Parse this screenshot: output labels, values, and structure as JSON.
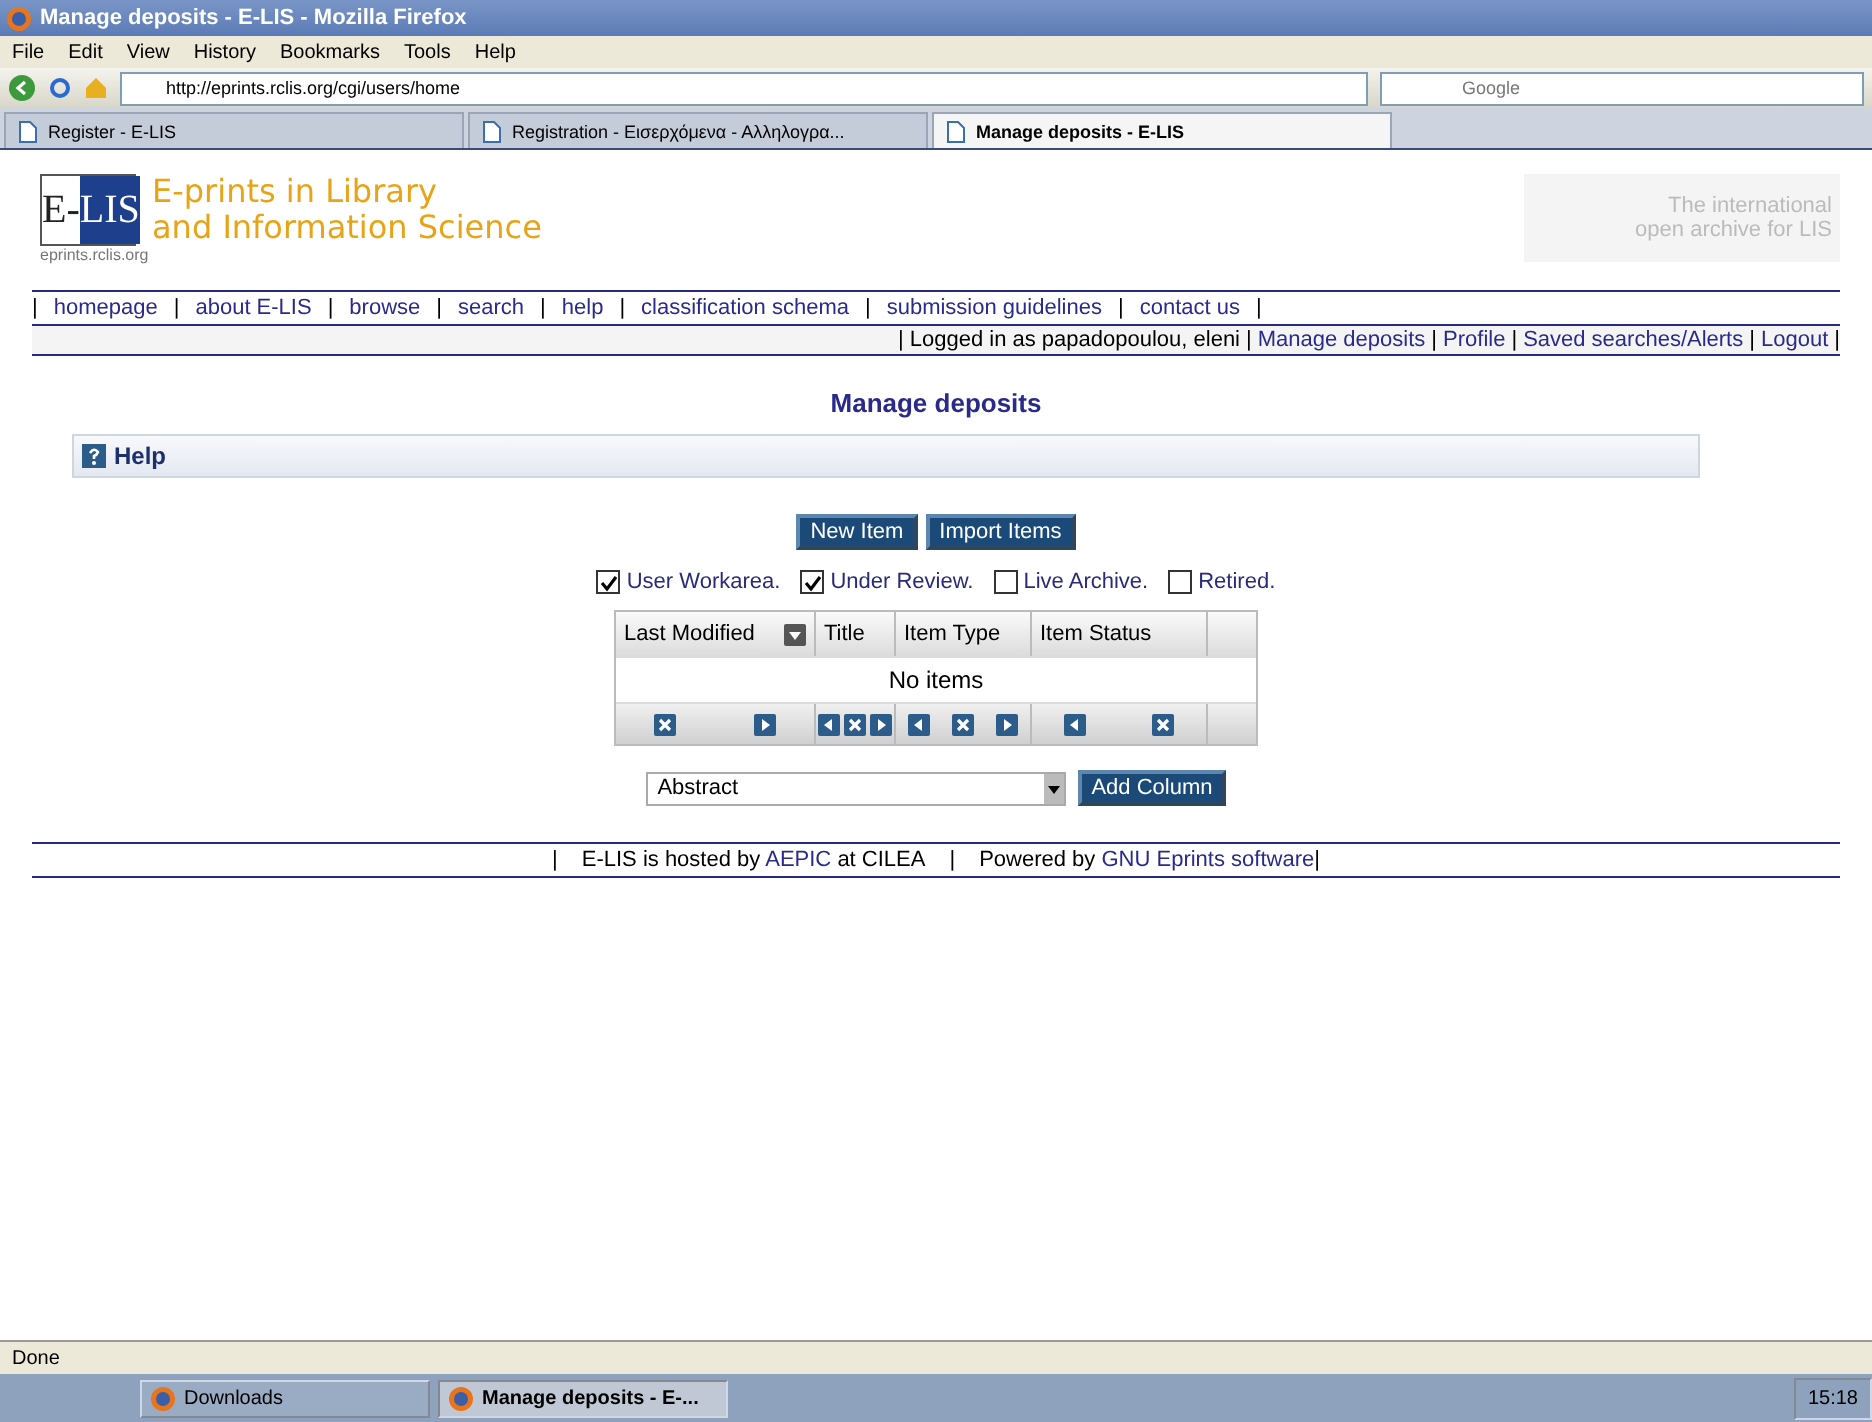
{
  "window": {
    "title": "Manage deposits - E-LIS - Mozilla Firefox"
  },
  "menu": [
    "File",
    "Edit",
    "View",
    "History",
    "Bookmarks",
    "Tools",
    "Help"
  ],
  "address": {
    "value": "http://eprints.rclis.org/cgi/users/home"
  },
  "search": {
    "placeholder": "Google"
  },
  "tabs": [
    {
      "label": "Register - E-LIS",
      "selected": false
    },
    {
      "label": "Registration - Εισερχόμενα - Αλληλογρα...",
      "selected": false
    },
    {
      "label": "Manage deposits - E-LIS",
      "selected": true
    }
  ],
  "site": {
    "logo_left": "E-",
    "logo_right": "LIS",
    "logo_url": "eprints.rclis.org",
    "title_line_1": "E-prints in Library",
    "title_line_2": "and Information Science",
    "tagline_1": "The international",
    "tagline_2": "open archive for LIS"
  },
  "separator": "|",
  "nav": [
    "homepage",
    "about E-LIS",
    "browse",
    "search",
    "help",
    "classification schema",
    "submission guidelines",
    "contact us"
  ],
  "user_bar": [
    {
      "text": "Logged in as papadopoulou, eleni",
      "link": false
    },
    {
      "text": "Manage deposits",
      "link": true
    },
    {
      "text": "Profile",
      "link": true
    },
    {
      "text": "Saved searches/Alerts",
      "link": true
    },
    {
      "text": "Logout",
      "link": true
    }
  ],
  "page_title": "Manage deposits",
  "help": {
    "label": "Help"
  },
  "buttons": [
    "New Item",
    "Import Items"
  ],
  "filters": [
    {
      "label": "User Workarea.",
      "checked": true
    },
    {
      "label": "Under Review.",
      "checked": true
    },
    {
      "label": "Live Archive.",
      "checked": false
    },
    {
      "label": "Retired.",
      "checked": false
    }
  ],
  "table": {
    "columns": [
      {
        "label": "Last Modified",
        "sorted": true,
        "controls": [
          {
            "kind": "remove"
          },
          {
            "kind": "right"
          }
        ]
      },
      {
        "label": "Title",
        "sorted": false,
        "controls": [
          {
            "kind": "left"
          },
          {
            "kind": "remove"
          },
          {
            "kind": "right"
          }
        ]
      },
      {
        "label": "Item Type",
        "sorted": false,
        "controls": [
          {
            "kind": "left"
          },
          {
            "kind": "remove"
          },
          {
            "kind": "right"
          }
        ]
      },
      {
        "label": "Item Status",
        "sorted": false,
        "controls": [
          {
            "kind": "left"
          },
          {
            "kind": "remove"
          }
        ]
      }
    ],
    "empty": "No items"
  },
  "add_column": {
    "value": "Abstract",
    "button": "Add Column"
  },
  "footer": {
    "part_1": "E-LIS is hosted by",
    "link_1": "AEPIC",
    "part_2": "at CILEA",
    "part_3": "Powered by",
    "link_2": "GNU Eprints software"
  },
  "status_bar": "Done",
  "taskbar": [
    {
      "label": "Downloads",
      "selected": false
    },
    {
      "label": "Manage deposits - E-...",
      "selected": true
    }
  ],
  "clock": "15:18"
}
